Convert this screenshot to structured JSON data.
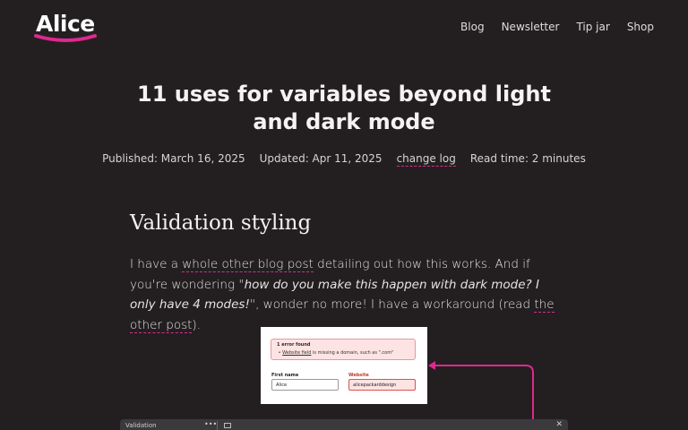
{
  "header": {
    "logo_text": "Alice",
    "nav": [
      "Blog",
      "Newsletter",
      "Tip jar",
      "Shop"
    ]
  },
  "article": {
    "title": "11 uses for variables beyond light and dark mode",
    "published": "Published: March 16, 2025",
    "updated": "Updated: Apr 11, 2025",
    "changelog": "change log",
    "read_time": "Read time: 2 minutes",
    "section_heading": "Validation styling",
    "para": {
      "t1": "I have a ",
      "link1": "whole other blog post",
      "t2": " detailing out how this works. And if you're wondering \"",
      "quote": "how do you make this happen with dark mode? I only have 4 modes!",
      "t3": "\", wonder no more! I have a workaround (read ",
      "link2": "the other post",
      "t4": ")."
    }
  },
  "embed": {
    "error_title": "1 error found",
    "error_link": "Website field",
    "error_rest": " is missing a domain, such as \".com\"",
    "first_name_label": "First name",
    "first_name_value": "Alice",
    "website_label": "Website",
    "website_value": "alicepackarddesign"
  },
  "bottom_bar": {
    "tab_label": "Validation",
    "more": "•••",
    "close": "✕"
  },
  "colors": {
    "background": "#231f20",
    "accent": "#e0288f"
  }
}
